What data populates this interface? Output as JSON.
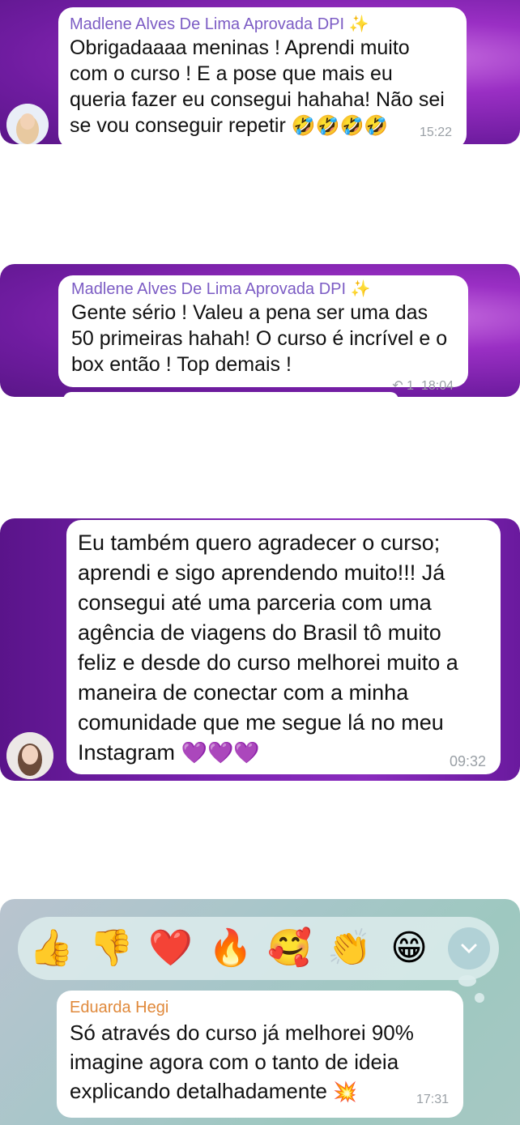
{
  "colors": {
    "purple_name": "#7c5cc4",
    "orange_name": "#e0893b",
    "time": "#9aa0a6"
  },
  "messages": [
    {
      "sender": "Madlene Alves De Lima Aprovada DPI",
      "text": "Obrigadaaaa meninas ! Aprendi muito com o curso ! E a pose que mais eu queria fazer eu consegui hahaha! Não sei se vou conseguir repetir",
      "line1": "Obrigadaaaa meninas ! Aprendi muito",
      "line2": "com o curso ! E a pose que mais eu",
      "line3": "queria fazer eu consegui hahaha! Não sei",
      "line4": "se vou conseguir repetir",
      "emojis": "🤣🤣🤣🤣",
      "time": "15:22"
    },
    {
      "sender": "Madlene Alves De Lima Aprovada DPI",
      "line1": "Gente sério ! Valeu a pena ser uma das",
      "line2": "50 primeiras hahah! O curso é incrível e o",
      "line3": "box então ! Top demais !",
      "reply_count": "1",
      "time": "18:04"
    },
    {
      "line1": "Eu também quero agradecer o curso;",
      "line2": "aprendi e sigo aprendendo muito!!! Já",
      "line3": "consegui até uma parceria com uma",
      "line4": "agência de viagens do Brasil tô muito",
      "line5": "feliz e desde do curso melhorei muito a",
      "line6": "maneira de conectar com a minha",
      "line7": "comunidade que me segue lá no meu",
      "line8": "Instagram",
      "emojis": "💜💜💜",
      "time": "09:32"
    },
    {
      "sender": "Eduarda Hegi",
      "line1": "Só através do curso já melhorei 90%",
      "line2": "imagine agora com o tanto de ideia",
      "line3": "explicando detalhadamente",
      "emoji": "💥",
      "time": "17:31"
    }
  ],
  "reactions": [
    "👍",
    "👎",
    "❤️",
    "🔥",
    "🥰",
    "👏",
    "😁"
  ],
  "sparkle": "✨"
}
